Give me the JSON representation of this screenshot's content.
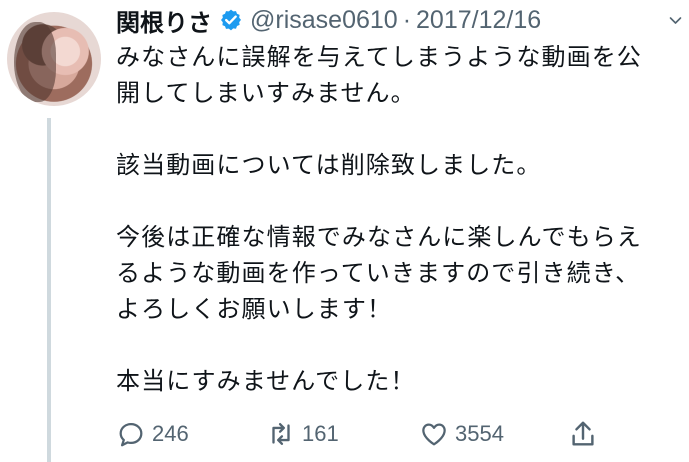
{
  "tweet": {
    "display_name": "関根りさ",
    "handle": "@risase0610",
    "separator": "·",
    "date": "2017/12/16",
    "text": "みなさんに誤解を与えてしまうような動画を公\n開してしまいすみません。\n\n該当動画については削除致しました。\n\n今後は正確な情報でみなさんに楽しんでもらえ\nるような動画を作っていきますので引き続き、\nよろしくお願いします！\n\n本当にすみませんでした！"
  },
  "actions": {
    "replies": "246",
    "retweets": "161",
    "likes": "3554"
  },
  "icons": [
    "avatar",
    "verified-badge-icon",
    "chevron-down-icon",
    "reply-icon",
    "retweet-icon",
    "like-icon",
    "share-icon"
  ],
  "colors": {
    "text": "#0f1419",
    "secondary_text": "#536471",
    "verified": "#1d9bf0",
    "thread_line": "#cfd9de"
  }
}
